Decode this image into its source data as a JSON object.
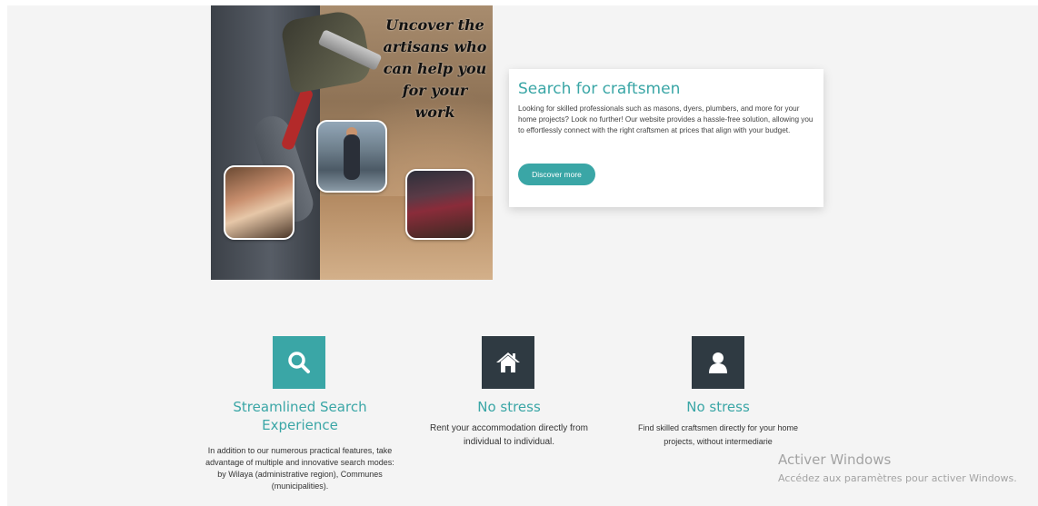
{
  "hero": {
    "title": "Uncover the artisans who can help you for your work"
  },
  "card": {
    "title": "Search for craftsmen",
    "description": "Looking for skilled professionals such as masons, dyers, plumbers, and more for your home projects? Look no further! Our website provides a hassle-free solution, allowing you to effortlessly connect with the right craftsmen at prices that align with your budget.",
    "button_label": "Discover more",
    "accent_color": "#3aa6a6"
  },
  "features": [
    {
      "icon": "search-icon",
      "title": "Streamlined Search Experience",
      "text": "In addition to our numerous practical features, take advantage of multiple and innovative search modes: by Wilaya (administrative region), Communes (municipalities)."
    },
    {
      "icon": "home-icon",
      "title": "No stress",
      "text": "Rent your accommodation directly from individual to individual."
    },
    {
      "icon": "user-icon",
      "title": "No stress",
      "text": "Find skilled craftsmen directly for your home projects, without intermediarie"
    }
  ],
  "watermark": {
    "line1": "Activer Windows",
    "line2": "Accédez aux paramètres pour activer Windows."
  }
}
